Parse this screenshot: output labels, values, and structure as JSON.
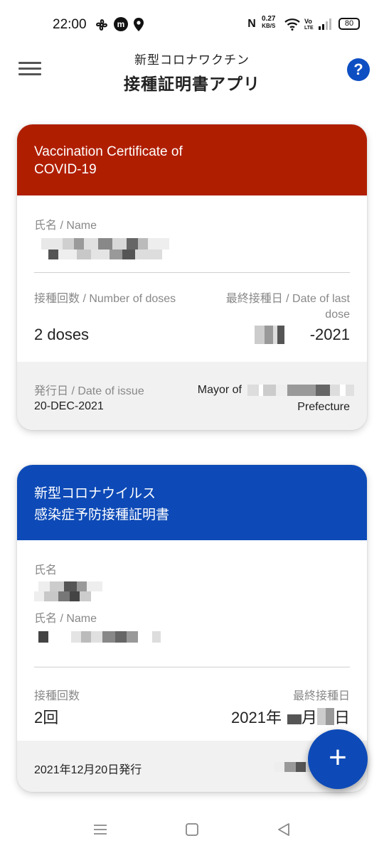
{
  "status_bar": {
    "time": "22:00",
    "speed_value": "0.27",
    "speed_unit": "KB/S",
    "volte_line1": "Vo",
    "volte_line2": "LTE",
    "battery": "80",
    "icons": [
      "fan-icon",
      "m-notification-icon",
      "location-icon",
      "nfc-icon",
      "wifi-icon",
      "signal-icon",
      "battery-icon"
    ]
  },
  "app_bar": {
    "subtitle": "新型コロナワクチン",
    "title": "接種証明書アプリ",
    "menu_icon": "hamburger-menu-icon",
    "help_icon": "help-icon",
    "help_glyph": "?"
  },
  "cards": [
    {
      "header": [
        "Vaccination Certificate of",
        "COVID-19"
      ],
      "name_label": "氏名 / Name",
      "doses_label": "接種回数 / Number of doses",
      "doses_value": "2 doses",
      "last_date_label": "最終接種日 / Date of last dose",
      "last_date_value": "-2021",
      "issue_label": "発行日 / Date of issue",
      "issue_value": "20-DEC-2021",
      "issuer_prefix": "Mayor of",
      "issuer_suffix": "Prefecture",
      "header_color": "#b01e00"
    },
    {
      "header": [
        "新型コロナウイルス",
        "感染症予防接種証明書"
      ],
      "name_label_jp": "氏名",
      "name_label": "氏名 / Name",
      "doses_label": "接種回数",
      "doses_value": "2回",
      "last_date_label": "最終接種日",
      "last_date_year": "2021年",
      "last_date_month": "月",
      "last_date_day": "日",
      "issue_value": "2021年12月20日発行",
      "header_color": "#0d4ab7"
    }
  ],
  "fab": {
    "glyph": "+",
    "icon": "add-icon"
  },
  "nav_bar": {
    "icons": [
      "recent-apps-icon",
      "home-icon",
      "back-icon"
    ]
  }
}
